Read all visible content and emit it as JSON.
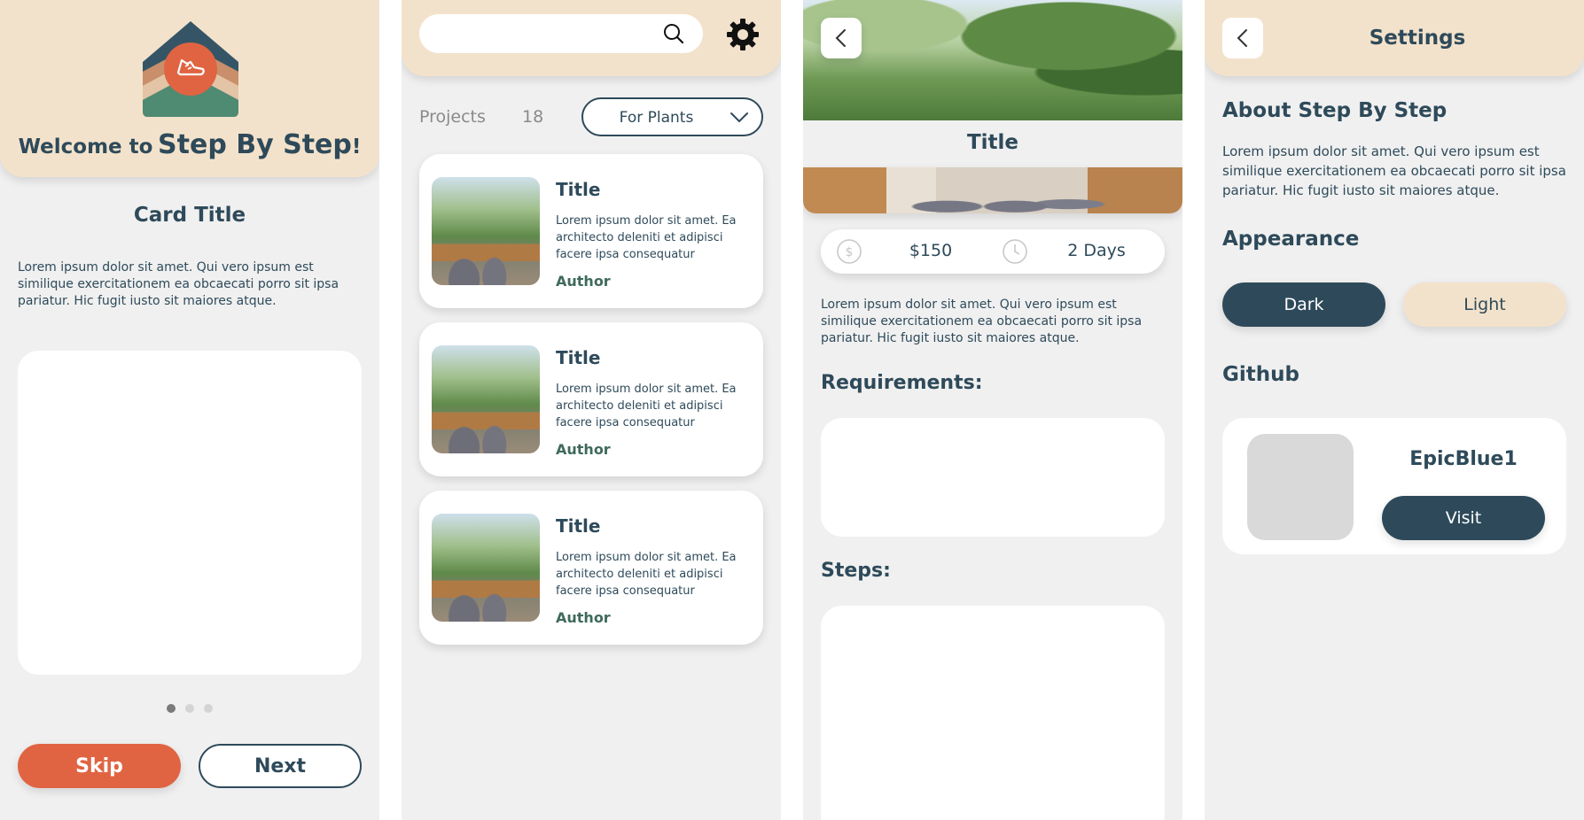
{
  "colors": {
    "beige": "#f3e2cb",
    "navy": "#2e4a5a",
    "orange": "#e06442",
    "panel": "#f0f0f0",
    "card": "#ffffff",
    "placeholder": "#d9d9d9"
  },
  "welcome": {
    "title_prefix": "Welcome to",
    "title_brand": "Step By Step",
    "title_suffix": "!",
    "card_title": "Card Title",
    "description": "Lorem ipsum dolor sit amet. Qui vero ipsum est similique exercitationem ea obcaecati porro sit ipsa pariatur. Hic fugit iusto sit maiores atque.",
    "pager": {
      "count": 3,
      "active": 1
    },
    "skip_label": "Skip",
    "next_label": "Next",
    "logo_icon": "sneaker-icon"
  },
  "projects": {
    "search_placeholder": "",
    "search_icon": "search-icon",
    "settings_icon": "gear-icon",
    "label": "Projects",
    "count": "18",
    "filter_selected": "For Plants",
    "items": [
      {
        "title": "Title",
        "description": "Lorem ipsum dolor sit amet. Ea architecto deleniti et adipisci facere ipsa consequatur",
        "author": "Author"
      },
      {
        "title": "Title",
        "description": "Lorem ipsum dolor sit amet. Ea architecto deleniti et adipisci facere ipsa consequatur",
        "author": "Author"
      },
      {
        "title": "Title",
        "description": "Lorem ipsum dolor sit amet. Ea architecto deleniti et adipisci facere ipsa consequatur",
        "author": "Author"
      }
    ]
  },
  "detail": {
    "back_icon": "chevron-left-icon",
    "title": "Title",
    "price": "$150",
    "price_icon": "dollar-icon",
    "duration": "2 Days",
    "duration_icon": "clock-icon",
    "description": "Lorem ipsum dolor sit amet. Qui vero ipsum est similique exercitationem ea obcaecati porro sit ipsa pariatur. Hic fugit iusto sit maiores atque.",
    "requirements_heading": "Requirements:",
    "steps_heading": "Steps:"
  },
  "settings": {
    "back_icon": "chevron-left-icon",
    "title": "Settings",
    "about_heading": "About Step By Step",
    "about_text": "Lorem ipsum dolor sit amet. Qui vero ipsum est similique exercitationem ea obcaecati porro sit ipsa pariatur. Hic fugit iusto sit maiores atque.",
    "appearance_heading": "Appearance",
    "dark_label": "Dark",
    "light_label": "Light",
    "github_heading": "Github",
    "github_user": "EpicBlue1",
    "visit_label": "Visit"
  }
}
